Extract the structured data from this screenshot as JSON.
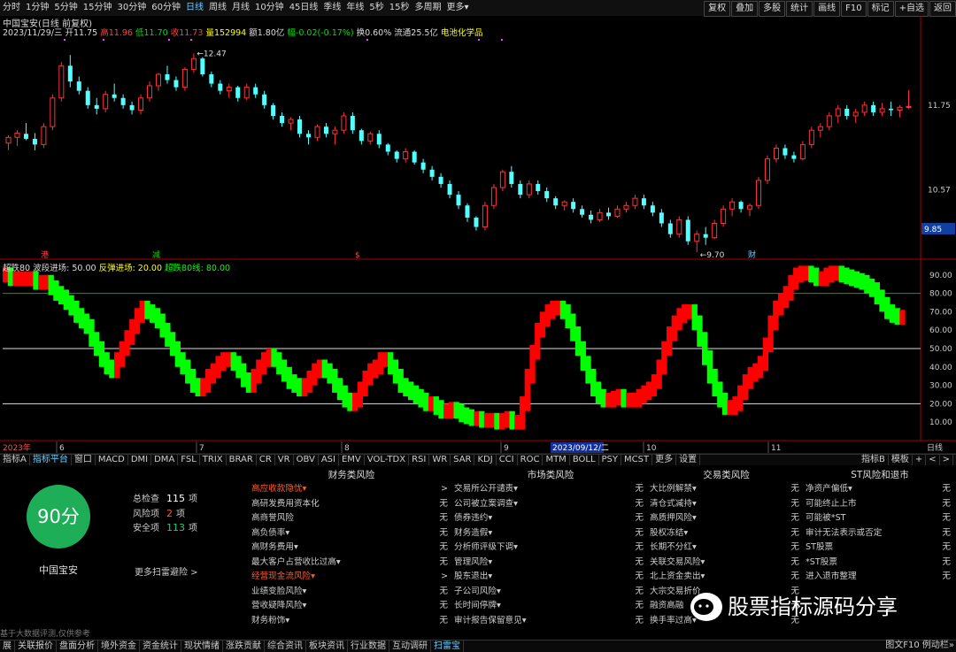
{
  "topbar": {
    "periods": [
      "分时",
      "1分钟",
      "5分钟",
      "15分钟",
      "30分钟",
      "60分钟",
      "日线",
      "周线",
      "月线",
      "10分钟",
      "45日线",
      "季线",
      "年线",
      "5秒",
      "15秒",
      "多周期",
      "更多▾"
    ],
    "active": "日线",
    "tools": [
      "复权",
      "叠加",
      "多股",
      "统计",
      "画线",
      "F10",
      "标记",
      "+自选",
      "返回"
    ]
  },
  "stock": {
    "name": "中国宝安",
    "title": "中国宝安(日线 前复权)",
    "date": "2023/11/29/三",
    "open": "开11.75",
    "high": "高11.96",
    "low": "低11.70",
    "close": "收11.73",
    "vol": "量152994",
    "amt": "额1.80亿",
    "chg": "幅-0.02(-0.17%)",
    "turn": "换0.60%",
    "flow": "流通25.5亿",
    "sector": "电池化学品"
  },
  "price_axis": [
    "11.75",
    "10.57"
  ],
  "price_marks": {
    "high": "12.47",
    "low": "9.70",
    "last": "9.85"
  },
  "chart_markers": [
    "港",
    "减",
    "$",
    "财"
  ],
  "indicator": {
    "name": "超跌80",
    "legend": [
      {
        "label": "波段进场: 50.00",
        "color": "#dddddd"
      },
      {
        "label": "反弹进场: 20.00",
        "color": "#ffff00"
      },
      {
        "label": "超跌80线: 80.00",
        "color": "#00ff00"
      }
    ],
    "axis": [
      "90.00",
      "80.00",
      "70.00",
      "60.00",
      "50.00",
      "40.00",
      "30.00",
      "20.00",
      "10.00"
    ]
  },
  "date_axis": {
    "year": "2023年",
    "months": [
      "6",
      "7",
      "8",
      "9",
      "10",
      "11"
    ],
    "cursor": "2023/09/12/二",
    "right": "日线"
  },
  "indicator_tabs": [
    "指标A",
    "指标平台",
    "窗口",
    "MACD",
    "DMI",
    "DMA",
    "FSL",
    "TRIX",
    "BRAR",
    "CR",
    "VR",
    "OBV",
    "ASI",
    "EMV",
    "VOL-TDX",
    "RSI",
    "WR",
    "SAR",
    "KDJ",
    "CCI",
    "ROC",
    "MTM",
    "BOLL",
    "PSY",
    "MCST",
    "更多",
    "设置"
  ],
  "indicator_tabs_active": "指标平台",
  "indicator_tabs_right": [
    "指标B",
    "模板",
    "+",
    "<",
    ">"
  ],
  "risk": {
    "score": "90分",
    "name": "中国宝安",
    "stats": [
      {
        "label": "总检查",
        "value": "115",
        "unit": "项",
        "color": "#ffffff"
      },
      {
        "label": "风险项",
        "value": "2",
        "unit": "项",
        "color": "#ff5b2a"
      },
      {
        "label": "安全项",
        "value": "113",
        "unit": "项",
        "color": "#1fd070"
      }
    ],
    "more": "更多扫雷避险 >",
    "note": "基于大数据评测,仅供参考",
    "columns": [
      {
        "title": "财务类风险",
        "rows": [
          [
            "高应收款隐忧▾",
            ">",
            "hl"
          ],
          [
            "高研发费用资本化",
            "无",
            ""
          ],
          [
            "高商誉风险",
            "无",
            ""
          ],
          [
            "高负债率▾",
            "无",
            ""
          ],
          [
            "高财务费用▾",
            "无",
            ""
          ],
          [
            "最大客户占营收比过高▾",
            "无",
            ""
          ],
          [
            "经营现金流风险▾",
            ">",
            "hl"
          ],
          [
            "业绩变脸风险▾",
            "无",
            ""
          ],
          [
            "营收疑降风险▾",
            "无",
            ""
          ],
          [
            "财务粉饰▾",
            "无",
            ""
          ]
        ]
      },
      {
        "title": "市场类风险",
        "rows": [
          [
            "交易所公开谴责▾",
            "无",
            ""
          ],
          [
            "公司被立案调查▾",
            "无",
            ""
          ],
          [
            "债券违约▾",
            "无",
            ""
          ],
          [
            "财务造假▾",
            "无",
            ""
          ],
          [
            "分析师评级下调▾",
            "无",
            ""
          ],
          [
            "管理风险▾",
            "无",
            ""
          ],
          [
            "股东退出▾",
            "无",
            ""
          ],
          [
            "子公司风险▾",
            "无",
            ""
          ],
          [
            "长时间停牌▾",
            "无",
            ""
          ],
          [
            "审计报告保留意见▾",
            "无",
            ""
          ]
        ]
      },
      {
        "title": "交易类风险",
        "rows": [
          [
            "大比例解禁▾",
            "无",
            ""
          ],
          [
            "清仓式减持▾",
            "无",
            ""
          ],
          [
            "高质押风险▾",
            "无",
            ""
          ],
          [
            "股权冻结▾",
            "无",
            ""
          ],
          [
            "长期不分红▾",
            "无",
            ""
          ],
          [
            "关联交易风险▾",
            "无",
            ""
          ],
          [
            "北上资金卖出▾",
            "无",
            ""
          ],
          [
            "大宗交易折价",
            "无",
            ""
          ],
          [
            "融资高融",
            "无",
            ""
          ],
          [
            "换手率过高▾",
            "无",
            ""
          ]
        ]
      },
      {
        "title": "ST风险和退市",
        "rows": [
          [
            "净资产偏低▾",
            "无",
            ""
          ],
          [
            "可能终止上市",
            "无",
            ""
          ],
          [
            "可能被*ST",
            "无",
            ""
          ],
          [
            "审计无法表示或否定",
            "无",
            ""
          ],
          [
            "ST股票",
            "无",
            ""
          ],
          [
            "*ST股票",
            "无",
            ""
          ],
          [
            "进入退市整理",
            "无",
            ""
          ]
        ]
      }
    ]
  },
  "watermark": "股票指标源码分享",
  "bottom_tabs": [
    "展",
    "关联报价",
    "盘面分析",
    "境外资金",
    "资金统计",
    "现状情绪",
    "涨跌贡献",
    "综合资讯",
    "板块资讯",
    "行业数据",
    "互动调研",
    "扫雷宝"
  ],
  "bottom_active": "扫雷宝",
  "bottom_right": "图文F10 例动栏»",
  "colors": {
    "up": "#ff3333",
    "down": "#54ffff",
    "bull": "#ff0000",
    "bear": "#00ff00",
    "accent": "#66ccff"
  },
  "chart_data": [
    {
      "type": "candlestick",
      "title": "中国宝安(日线 前复权)",
      "y_axis_ticks": [
        11.75,
        10.57
      ],
      "ylim": [
        9.6,
        12.6
      ],
      "high_mark": 12.47,
      "low_mark": 9.7,
      "candles": [
        [
          11.22,
          11.33,
          11.12,
          11.3
        ],
        [
          11.3,
          11.4,
          11.18,
          11.36
        ],
        [
          11.35,
          11.5,
          11.26,
          11.28
        ],
        [
          11.28,
          11.36,
          11.12,
          11.2
        ],
        [
          11.2,
          11.5,
          11.15,
          11.45
        ],
        [
          11.45,
          11.9,
          11.4,
          11.85
        ],
        [
          11.85,
          12.35,
          11.8,
          12.3
        ],
        [
          12.3,
          12.45,
          12.0,
          12.08
        ],
        [
          12.08,
          12.15,
          11.9,
          11.95
        ],
        [
          11.95,
          12.0,
          11.7,
          11.75
        ],
        [
          11.75,
          11.85,
          11.62,
          11.7
        ],
        [
          11.7,
          11.95,
          11.65,
          11.9
        ],
        [
          11.9,
          12.05,
          11.8,
          11.85
        ],
        [
          11.85,
          11.9,
          11.7,
          11.75
        ],
        [
          11.75,
          11.8,
          11.62,
          11.68
        ],
        [
          11.68,
          11.9,
          11.62,
          11.85
        ],
        [
          11.85,
          12.08,
          11.8,
          12.02
        ],
        [
          12.02,
          12.2,
          11.95,
          12.18
        ],
        [
          12.18,
          12.3,
          12.05,
          12.1
        ],
        [
          12.1,
          12.15,
          11.95,
          12.0
        ],
        [
          12.0,
          12.28,
          11.95,
          12.25
        ],
        [
          12.25,
          12.47,
          12.2,
          12.4
        ],
        [
          12.4,
          12.42,
          12.15,
          12.18
        ],
        [
          12.18,
          12.22,
          12.0,
          12.05
        ],
        [
          12.05,
          12.1,
          11.9,
          11.95
        ],
        [
          11.95,
          12.05,
          11.85,
          12.0
        ],
        [
          12.0,
          12.02,
          11.8,
          11.85
        ],
        [
          11.85,
          12.05,
          11.82,
          12.0
        ],
        [
          12.0,
          12.05,
          11.85,
          11.9
        ],
        [
          11.9,
          11.95,
          11.7,
          11.75
        ],
        [
          11.75,
          11.78,
          11.55,
          11.6
        ],
        [
          11.6,
          11.65,
          11.45,
          11.5
        ],
        [
          11.5,
          11.58,
          11.4,
          11.55
        ],
        [
          11.55,
          11.6,
          11.3,
          11.35
        ],
        [
          11.35,
          11.4,
          11.2,
          11.3
        ],
        [
          11.3,
          11.48,
          11.25,
          11.45
        ],
        [
          11.45,
          11.5,
          11.3,
          11.35
        ],
        [
          11.35,
          11.45,
          11.2,
          11.4
        ],
        [
          11.4,
          11.65,
          11.35,
          11.6
        ],
        [
          11.6,
          11.65,
          11.35,
          11.4
        ],
        [
          11.4,
          11.42,
          11.2,
          11.25
        ],
        [
          11.25,
          11.38,
          11.2,
          11.35
        ],
        [
          11.35,
          11.4,
          11.15,
          11.2
        ],
        [
          11.2,
          11.22,
          11.05,
          11.1
        ],
        [
          11.1,
          11.12,
          10.95,
          11.0
        ],
        [
          11.0,
          11.15,
          10.95,
          11.1
        ],
        [
          11.1,
          11.12,
          10.92,
          10.95
        ],
        [
          10.95,
          11.0,
          10.8,
          10.85
        ],
        [
          10.85,
          10.9,
          10.7,
          10.75
        ],
        [
          10.75,
          10.8,
          10.6,
          10.65
        ],
        [
          10.65,
          10.7,
          10.45,
          10.5
        ],
        [
          10.5,
          10.55,
          10.3,
          10.35
        ],
        [
          10.35,
          10.38,
          10.12,
          10.18
        ],
        [
          10.18,
          10.2,
          10.0,
          10.05
        ],
        [
          10.05,
          10.4,
          10.0,
          10.35
        ],
        [
          10.35,
          10.65,
          10.3,
          10.6
        ],
        [
          10.6,
          10.85,
          10.55,
          10.82
        ],
        [
          10.82,
          10.9,
          10.6,
          10.65
        ],
        [
          10.65,
          10.7,
          10.45,
          10.5
        ],
        [
          10.5,
          10.7,
          10.45,
          10.65
        ],
        [
          10.65,
          10.7,
          10.5,
          10.55
        ],
        [
          10.55,
          10.6,
          10.4,
          10.45
        ],
        [
          10.45,
          10.48,
          10.3,
          10.35
        ],
        [
          10.35,
          10.42,
          10.28,
          10.4
        ],
        [
          10.4,
          10.45,
          10.25,
          10.3
        ],
        [
          10.3,
          10.35,
          10.18,
          10.22
        ],
        [
          10.22,
          10.28,
          10.1,
          10.15
        ],
        [
          10.15,
          10.3,
          10.12,
          10.25
        ],
        [
          10.25,
          10.32,
          10.15,
          10.2
        ],
        [
          10.2,
          10.35,
          10.18,
          10.3
        ],
        [
          10.3,
          10.4,
          10.25,
          10.35
        ],
        [
          10.35,
          10.5,
          10.3,
          10.45
        ],
        [
          10.45,
          10.5,
          10.3,
          10.35
        ],
        [
          10.35,
          10.4,
          10.2,
          10.25
        ],
        [
          10.25,
          10.3,
          10.05,
          10.1
        ],
        [
          10.1,
          10.15,
          9.9,
          9.95
        ],
        [
          9.95,
          10.2,
          9.9,
          10.15
        ],
        [
          10.15,
          10.2,
          9.8,
          9.85
        ],
        [
          9.85,
          10.0,
          9.7,
          9.95
        ],
        [
          9.95,
          10.05,
          9.8,
          9.9
        ],
        [
          9.9,
          10.15,
          9.88,
          10.1
        ],
        [
          10.1,
          10.35,
          10.05,
          10.3
        ],
        [
          10.3,
          10.45,
          10.2,
          10.4
        ],
        [
          10.4,
          10.42,
          10.25,
          10.3
        ],
        [
          10.3,
          10.38,
          10.2,
          10.35
        ],
        [
          10.35,
          10.75,
          10.3,
          10.7
        ],
        [
          10.7,
          11.05,
          10.65,
          11.0
        ],
        [
          11.0,
          11.2,
          10.95,
          11.15
        ],
        [
          11.15,
          11.2,
          11.0,
          11.05
        ],
        [
          11.05,
          11.1,
          10.95,
          11.0
        ],
        [
          11.0,
          11.25,
          10.98,
          11.2
        ],
        [
          11.2,
          11.45,
          11.15,
          11.4
        ],
        [
          11.4,
          11.5,
          11.3,
          11.45
        ],
        [
          11.45,
          11.65,
          11.4,
          11.6
        ],
        [
          11.6,
          11.75,
          11.5,
          11.7
        ],
        [
          11.7,
          11.75,
          11.55,
          11.6
        ],
        [
          11.6,
          11.7,
          11.5,
          11.65
        ],
        [
          11.65,
          11.8,
          11.6,
          11.75
        ],
        [
          11.75,
          11.8,
          11.6,
          11.65
        ],
        [
          11.65,
          11.78,
          11.6,
          11.7
        ],
        [
          11.7,
          11.8,
          11.6,
          11.68
        ],
        [
          11.68,
          11.75,
          11.58,
          11.72
        ],
        [
          11.72,
          11.96,
          11.7,
          11.73
        ]
      ]
    },
    {
      "type": "area",
      "title": "超跌80",
      "series": [
        {
          "name": "超跌80",
          "values": [
            90,
            88,
            88,
            88,
            88,
            88,
            86,
            86,
            86,
            83,
            80,
            78,
            75,
            72,
            68,
            65,
            62,
            55,
            50,
            44,
            40,
            38,
            44,
            50,
            56,
            62,
            68,
            72,
            70,
            68,
            65,
            60,
            55,
            50,
            44,
            40,
            35,
            30,
            28,
            30,
            35,
            38,
            42,
            44,
            44,
            42,
            38,
            33,
            30,
            35,
            40,
            44,
            46,
            44,
            40,
            36,
            32,
            30,
            28,
            30,
            34,
            38,
            40,
            38,
            35,
            30,
            26,
            22,
            20,
            22,
            28,
            34,
            38,
            40,
            44,
            44,
            40,
            35,
            30,
            28,
            26,
            24,
            22,
            20,
            20,
            18,
            16,
            16,
            17,
            16,
            14,
            13,
            12,
            12,
            11,
            11,
            11,
            10,
            11,
            12,
            10,
            10,
            20,
            35,
            48,
            60,
            66,
            70,
            72,
            72,
            70,
            65,
            58,
            50,
            42,
            35,
            28,
            24,
            22,
            22,
            23,
            24,
            22,
            22,
            22,
            24,
            26,
            28,
            32,
            40,
            50,
            58,
            64,
            68,
            70,
            70,
            64,
            55,
            45,
            35,
            28,
            22,
            18,
            18,
            20,
            26,
            32,
            36,
            38,
            42,
            52,
            64,
            72,
            76,
            80,
            86,
            90,
            91,
            91,
            90,
            88,
            88,
            90,
            91,
            91,
            90,
            89,
            88,
            87,
            86,
            84,
            82,
            78,
            74,
            70,
            68,
            67,
            67
          ]
        }
      ],
      "ylim": [
        0,
        100
      ],
      "reference_lines": [
        80,
        50,
        20
      ]
    }
  ]
}
